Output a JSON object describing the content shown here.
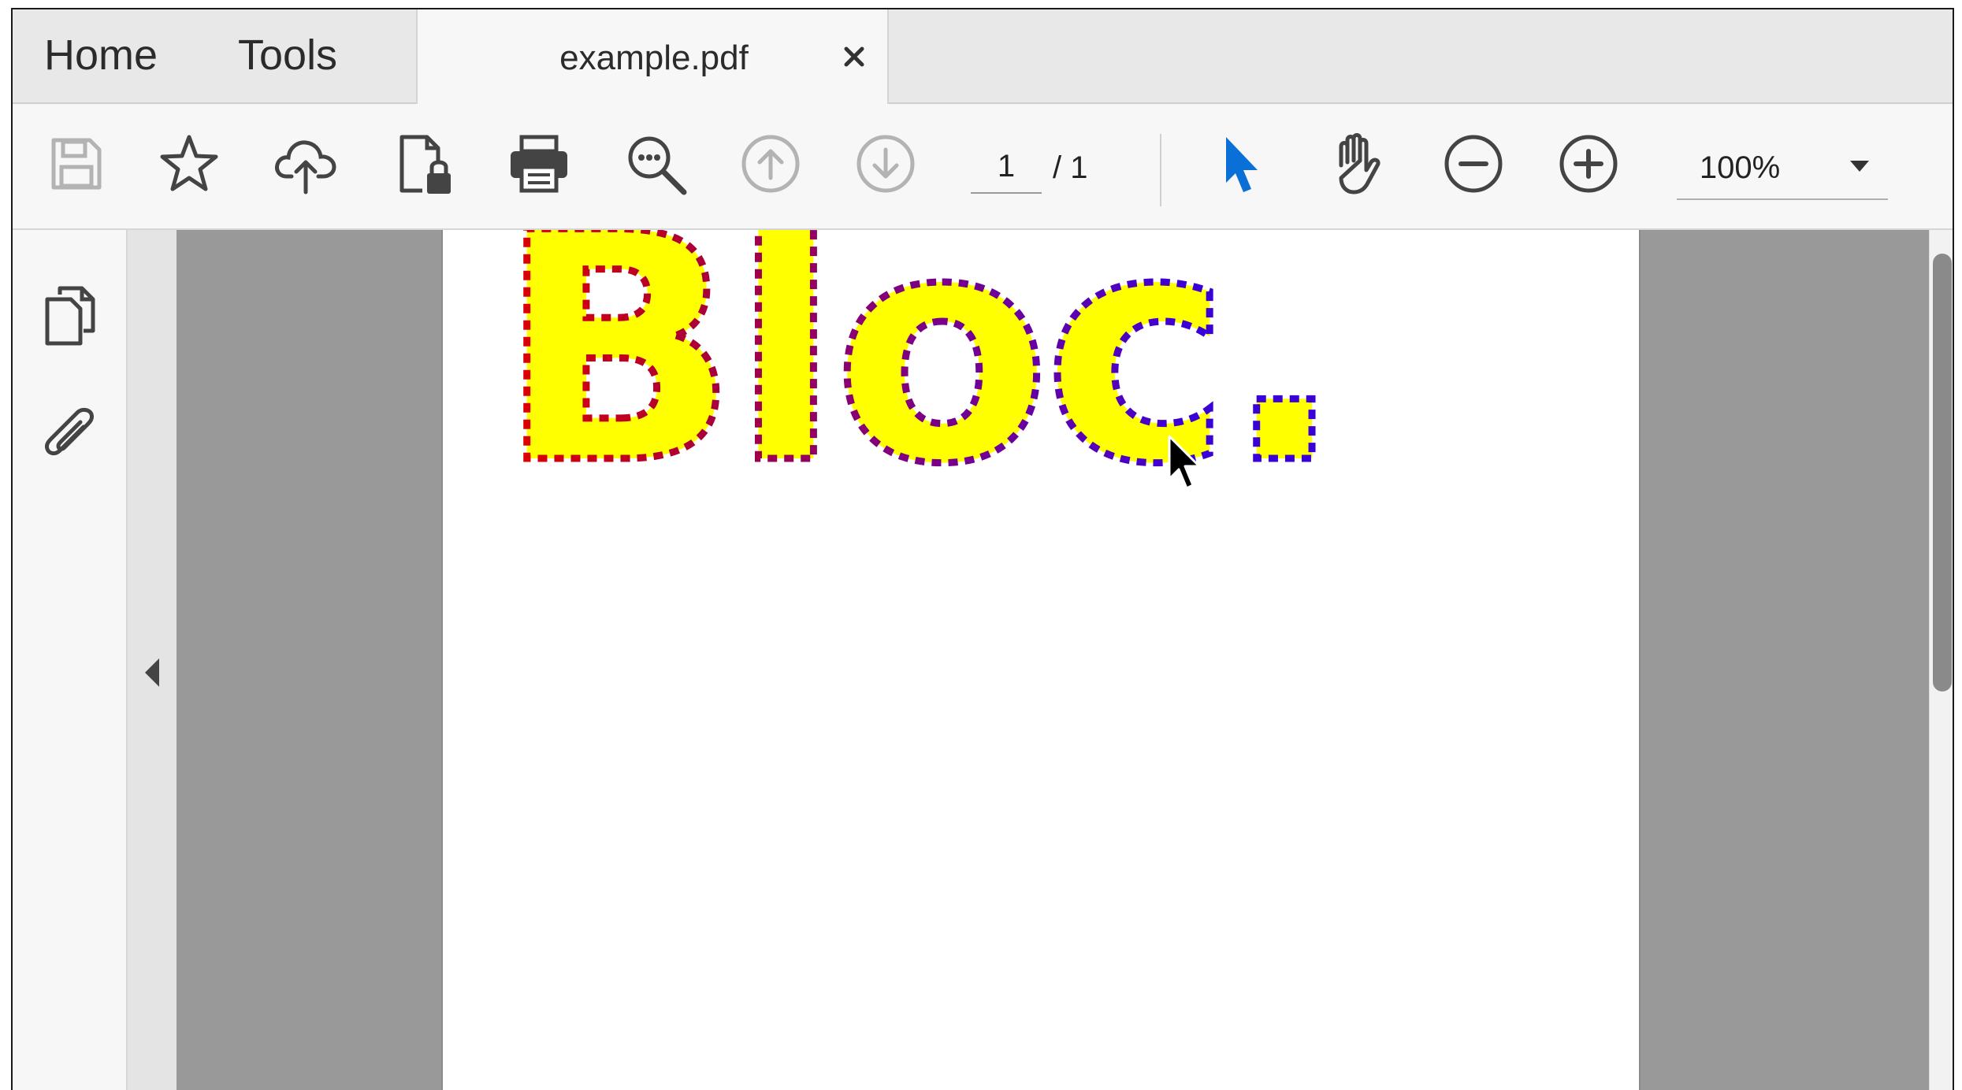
{
  "tabs": {
    "home": "Home",
    "tools": "Tools",
    "document": "example.pdf"
  },
  "toolbar": {
    "page_current": "1",
    "page_total": "/ 1",
    "zoom": "100%",
    "icons": [
      "save-icon",
      "star-icon",
      "cloud-upload-icon",
      "protect-file-icon",
      "print-icon",
      "search-icon",
      "page-up-icon",
      "page-down-icon",
      "select-cursor-icon",
      "hand-icon",
      "zoom-out-icon",
      "zoom-in-icon"
    ],
    "accent_color": "#0a6fd6"
  },
  "left_panel": {
    "icons": [
      "pages-icon",
      "attachment-icon"
    ]
  },
  "document": {
    "text": "Bloc.",
    "fill_color": "#ffff00",
    "outline_colors": [
      "#e00000",
      "#b00030",
      "#8a0070",
      "#6a00a0",
      "#3a00d8"
    ]
  }
}
